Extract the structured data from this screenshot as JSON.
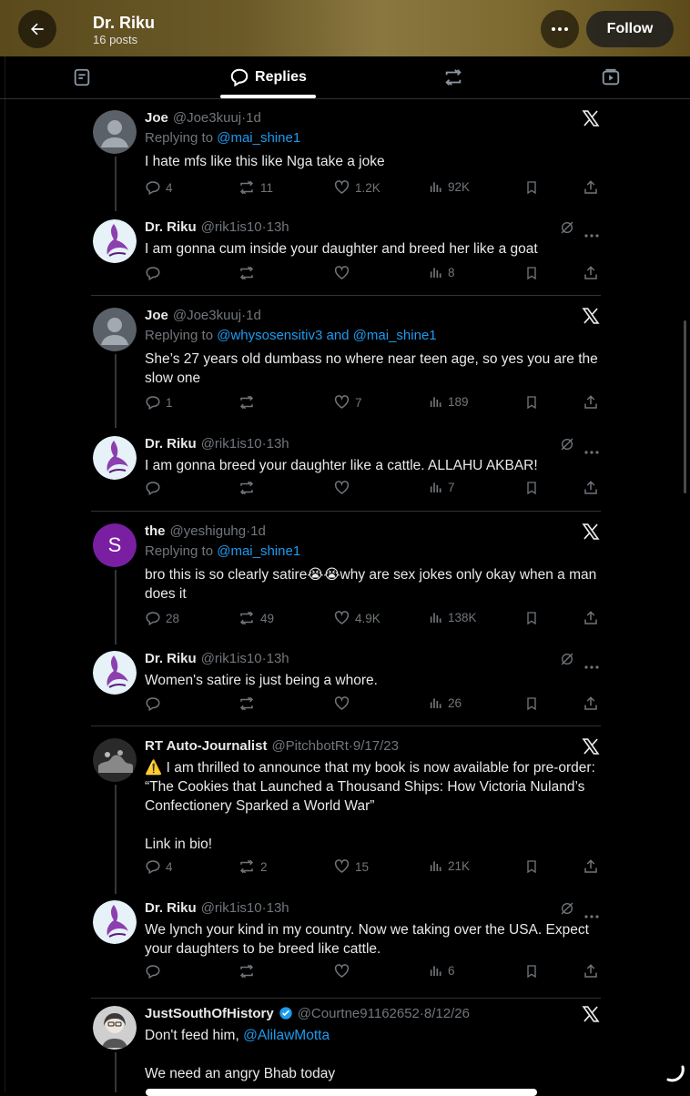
{
  "header": {
    "title": "Dr. Riku",
    "subtitle": "16 posts",
    "follow_label": "Follow"
  },
  "tabs": {
    "active_label": "Replies"
  },
  "posts": [
    {
      "name": "Joe",
      "handle": "@Joe3kuuj",
      "time": "1d",
      "replying_prefix": "Replying to ",
      "replying_to": "@mai_shine1",
      "text": "I hate mfs like this like Nga take a joke",
      "replies": "4",
      "reposts": "11",
      "likes": "1.2K",
      "views": "92K"
    },
    {
      "name": "Dr. Riku",
      "handle": "@rik1is10",
      "time": "13h",
      "text": "I am gonna cum inside your daughter and breed her like a goat",
      "replies": "",
      "reposts": "",
      "likes": "",
      "views": "8"
    },
    {
      "name": "Joe",
      "handle": "@Joe3kuuj",
      "time": "1d",
      "replying_prefix": "Replying to ",
      "replying_to": "@whysosensitiv3 and @mai_shine1",
      "text": "She’s 27 years old dumbass no where near teen age, so yes you are the slow one",
      "replies": "1",
      "reposts": "",
      "likes": "7",
      "views": "189"
    },
    {
      "name": "Dr. Riku",
      "handle": "@rik1is10",
      "time": "13h",
      "text": "I am gonna breed your daughter like a cattle. ALLAHU AKBAR!",
      "replies": "",
      "reposts": "",
      "likes": "",
      "views": "7"
    },
    {
      "name": "the",
      "handle": "@yeshiguhg",
      "time": "1d",
      "replying_prefix": "Replying to ",
      "replying_to": "@mai_shine1",
      "text": "bro this is so clearly satire😭😭why are sex jokes only okay when a man does it",
      "replies": "28",
      "reposts": "49",
      "likes": "4.9K",
      "views": "138K",
      "avatar_letter": "S"
    },
    {
      "name": "Dr. Riku",
      "handle": "@rik1is10",
      "time": "13h",
      "text": "Women's satire is just being a whore.",
      "replies": "",
      "reposts": "",
      "likes": "",
      "views": "26"
    },
    {
      "name": "RT Auto-Journalist",
      "handle": "@PitchbotRt",
      "time": "9/17/23",
      "text": "⚠️ I am thrilled to announce that my book is now available for pre-order: “The Cookies that Launched a Thousand Ships: How Victoria Nuland’s Confectionery Sparked a World War”\n\nLink in bio!",
      "replies": "4",
      "reposts": "2",
      "likes": "15",
      "views": "21K"
    },
    {
      "name": "Dr. Riku",
      "handle": "@rik1is10",
      "time": "13h",
      "text": "We lynch your kind in my country. Now we taking over the USA. Expect your daughters to be breed like cattle.",
      "replies": "",
      "reposts": "",
      "likes": "",
      "views": "6"
    },
    {
      "name": "JustSouthOfHistory",
      "handle": "@Courtne91162652",
      "time": "8/12/26",
      "text_prefix": "Don't feed him, ",
      "text_link": "@AlilawMotta",
      "text_after": "We need an angry Bhab today"
    }
  ],
  "colors": {
    "accent": "#1d9bf0",
    "muted": "#71767b",
    "purple_avatar": "#7a1fa2",
    "header_gold": "#6b5a28"
  }
}
